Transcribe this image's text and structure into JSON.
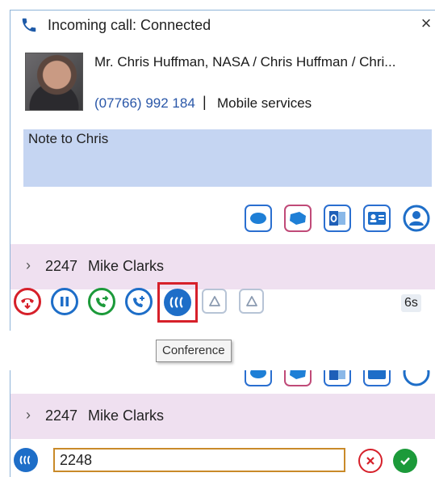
{
  "window": {
    "title": "Incoming call: Connected",
    "close_glyph": "×",
    "icon": "phone-icon"
  },
  "contact": {
    "name": "Mr. Chris Huffman, NASA / Chris Huffman / Chri...",
    "phone": "(07766) 992 184",
    "separator": "|",
    "provider": "Mobile services"
  },
  "note": {
    "text": "Note to Chris"
  },
  "actions": [
    {
      "name": "skype-icon"
    },
    {
      "name": "skype-business-icon"
    },
    {
      "name": "outlook-icon"
    },
    {
      "name": "contact-card-icon"
    },
    {
      "name": "user-icon"
    }
  ],
  "contact_row": {
    "chevron": "›",
    "extension": "2247",
    "contact_name": "Mike Clarks"
  },
  "call_controls": {
    "buttons": [
      "hangup",
      "hold",
      "transfer",
      "consult-transfer",
      "conference",
      "park",
      "unpark"
    ],
    "timer": "6s",
    "colors": {
      "hangup": "#d6202a",
      "hold": "#1e6ec8",
      "transfer": "#1c9a3a",
      "consult": "#1e6ec8",
      "conference": "#1e6ec8"
    }
  },
  "tooltip": {
    "text": "Conference"
  },
  "conference_panel": {
    "contact_row": {
      "chevron": "›",
      "extension": "2247",
      "contact_name": "Mike Clarks"
    },
    "input_value": "2248",
    "cancel_icon": "cancel-icon",
    "confirm_icon": "confirm-icon"
  }
}
